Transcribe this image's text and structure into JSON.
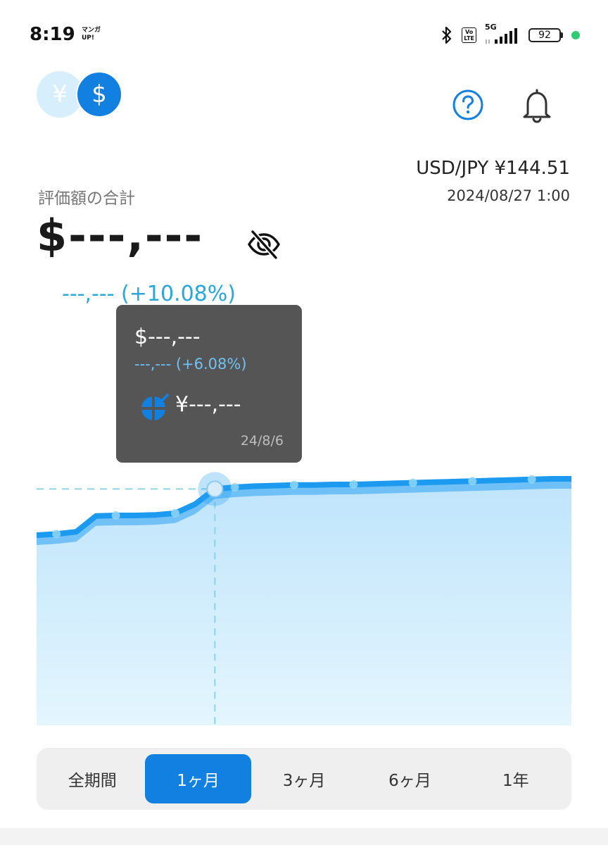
{
  "status_bar": {
    "time": "8:19",
    "app_badge_line1": "マンガ",
    "app_badge_line2": "UP!",
    "volte_line1": "Vo",
    "volte_line2": "LTE",
    "network": "5G",
    "battery": "92"
  },
  "header": {
    "yen_symbol": "¥",
    "usd_symbol": "$",
    "help_icon": "help-circle-icon",
    "bell_icon": "bell-icon"
  },
  "rate": {
    "pair_text": "USD/JPY ¥144.51",
    "date_text": "2024/08/27 1:00"
  },
  "valuation": {
    "label": "評価額の合計",
    "value": "$---,---",
    "change": "---,--- (+10.08%)"
  },
  "tooltip": {
    "value": "$---,---",
    "change": "---,--- (+6.08%)",
    "yen_value": "¥---,---",
    "date": "24/8/6"
  },
  "chart_data": {
    "type": "area",
    "x_label": "",
    "y_label": "",
    "series": [
      {
        "values": [
          0.0,
          0.02,
          0.06,
          0.34,
          0.35,
          0.35,
          0.36,
          0.39,
          0.55,
          0.82,
          0.85,
          0.87,
          0.88,
          0.89,
          0.89,
          0.9,
          0.9,
          0.91,
          0.92,
          0.93,
          0.94,
          0.95,
          0.96,
          0.97,
          0.98,
          0.99,
          1.0,
          1.0
        ]
      }
    ],
    "highlighted_index": 9,
    "colors": {
      "line": "#2ba3f2",
      "fill_top": "#bfe4fb",
      "fill_bottom": "#e4f6fe",
      "guide": "#8fd3e4"
    }
  },
  "period_tabs": [
    {
      "label": "全期間",
      "active": false
    },
    {
      "label": "1ヶ月",
      "active": true
    },
    {
      "label": "3ヶ月",
      "active": false
    },
    {
      "label": "6ヶ月",
      "active": false
    },
    {
      "label": "1年",
      "active": false
    }
  ]
}
